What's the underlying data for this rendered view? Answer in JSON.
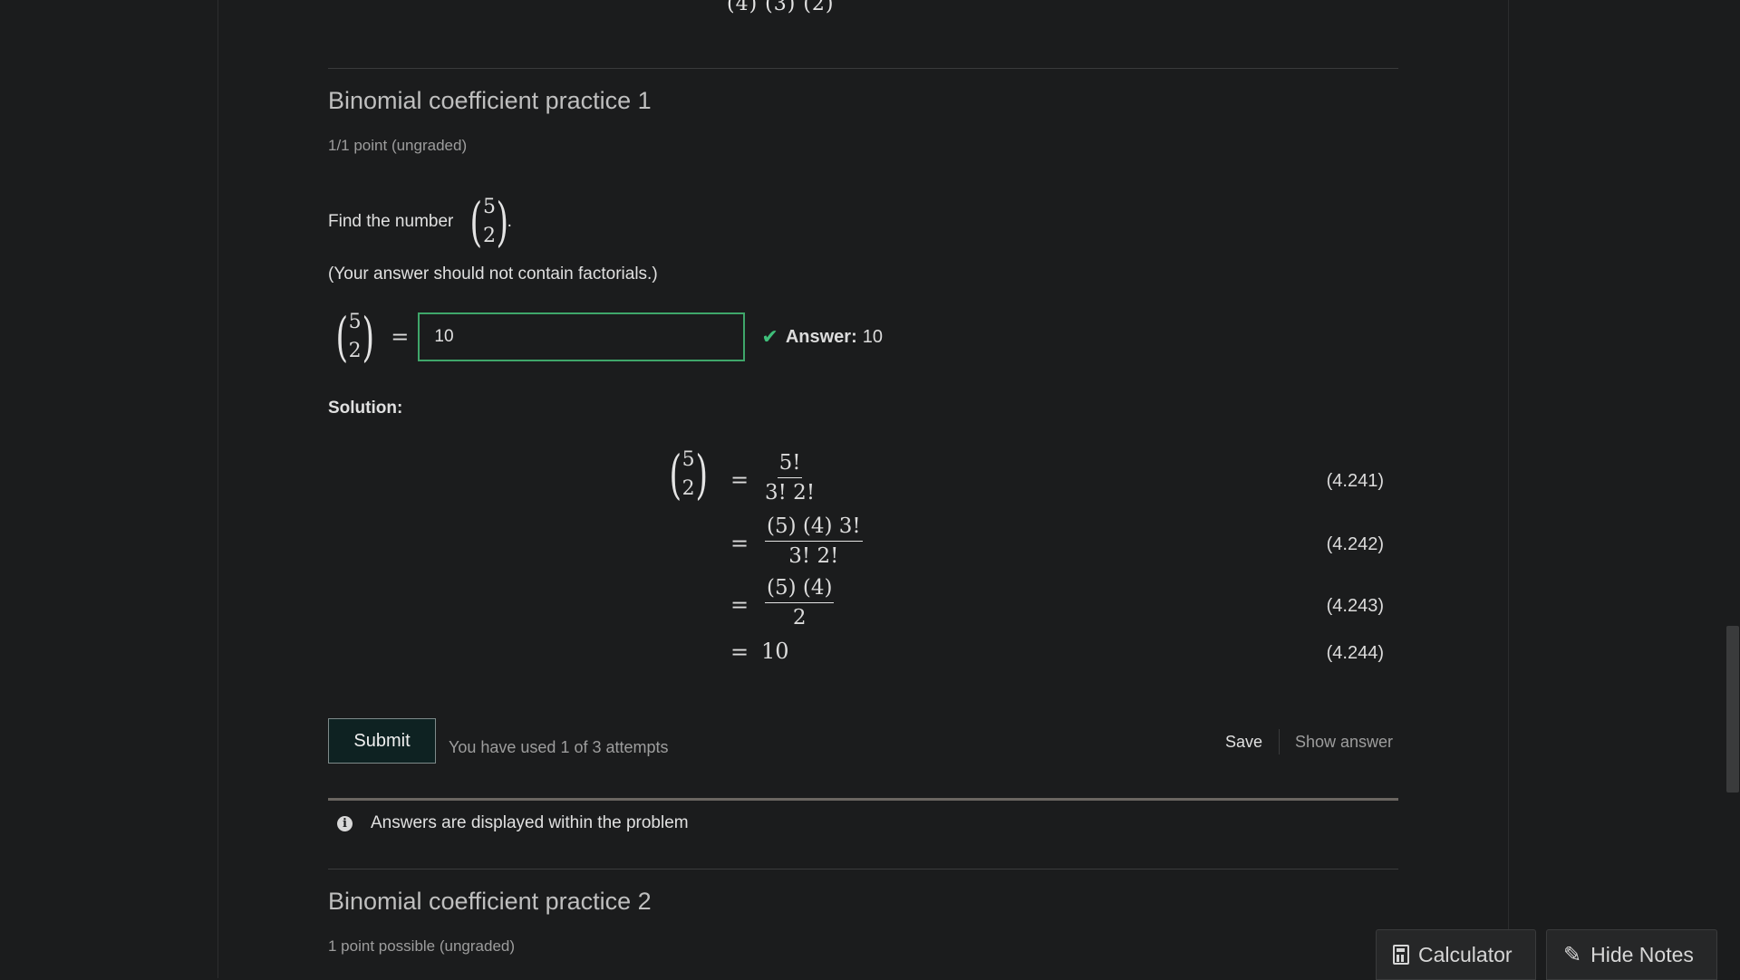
{
  "top_math_fragment": "(4) (3) (2)",
  "problem1": {
    "title": "Binomial coefficient practice 1",
    "points": "1/1 point (ungraded)",
    "prompt": "Find the number",
    "prompt_end": ".",
    "note": "(Your answer should not contain factorials.)",
    "binom_top": "5",
    "binom_bottom": "2",
    "equals": "=",
    "input_value": "10",
    "answer_label": "Answer:",
    "answer_value": "10",
    "solution_label": "Solution:",
    "solution_steps": [
      {
        "num": "5!",
        "den": "3! 2!",
        "eqnum": "(4.241)"
      },
      {
        "num": "(5) (4) 3!",
        "den": "3! 2!",
        "eqnum": "(4.242)"
      },
      {
        "num": "(5) (4)",
        "den": "2",
        "eqnum": "(4.243)"
      },
      {
        "value": "10",
        "eqnum": "(4.244)"
      }
    ],
    "submit_label": "Submit",
    "attempts_text": "You have used 1 of 3 attempts",
    "save_label": "Save",
    "show_answer_label": "Show answer",
    "notice_text": "Answers are displayed within the problem"
  },
  "problem2": {
    "title": "Binomial coefficient practice 2",
    "points": "1 point possible (ungraded)"
  },
  "floating": {
    "calculator_label": "Calculator",
    "hide_notes_label": "Hide Notes"
  },
  "icons": {
    "check": "check-icon",
    "info": "info-icon",
    "calculator": "calculator-icon",
    "pencil": "pencil-icon"
  },
  "colors": {
    "background": "#1b1c1d",
    "correct_green": "#3fbf7a",
    "input_border": "#3fa66a",
    "submit_bg": "#0e2222"
  }
}
